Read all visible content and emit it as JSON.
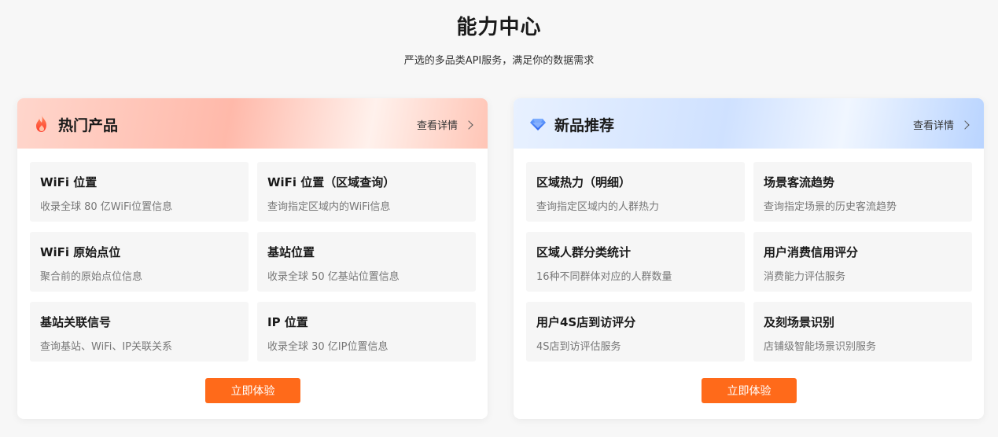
{
  "page": {
    "title": "能力中心",
    "subtitle": "严选的多品类API服务，满足你的数据需求"
  },
  "hot": {
    "title": "热门产品",
    "detail_label": "查看详情",
    "icon": "flame-icon",
    "accent_color": "#ff6a3d",
    "items": [
      {
        "name": "WiFi 位置",
        "desc": "收录全球 80 亿WiFi位置信息"
      },
      {
        "name": "WiFi 位置（区域查询）",
        "desc": "查询指定区域内的WiFi信息"
      },
      {
        "name": "WiFi 原始点位",
        "desc": "聚合前的原始点位信息"
      },
      {
        "name": "基站位置",
        "desc": "收录全球 50 亿基站位置信息"
      },
      {
        "name": "基站关联信号",
        "desc": "查询基站、WiFi、IP关联关系"
      },
      {
        "name": "IP 位置",
        "desc": "收录全球 30 亿IP位置信息"
      }
    ],
    "cta_label": "立即体验"
  },
  "new": {
    "title": "新品推荐",
    "detail_label": "查看详情",
    "icon": "diamond-icon",
    "accent_color": "#3d7bff",
    "items": [
      {
        "name": "区域热力（明细）",
        "desc": "查询指定区域内的人群热力"
      },
      {
        "name": "场景客流趋势",
        "desc": "查询指定场景的历史客流趋势"
      },
      {
        "name": "区域人群分类统计",
        "desc": "16种不同群体对应的人群数量"
      },
      {
        "name": "用户消费信用评分",
        "desc": "消费能力评估服务"
      },
      {
        "name": "用户4S店到访评分",
        "desc": "4S店到访评估服务"
      },
      {
        "name": "及刻场景识别",
        "desc": "店铺级智能场景识别服务"
      }
    ],
    "cta_label": "立即体验"
  },
  "colors": {
    "cta": "#ff6a1a",
    "tile_bg": "#f6f6f6"
  }
}
